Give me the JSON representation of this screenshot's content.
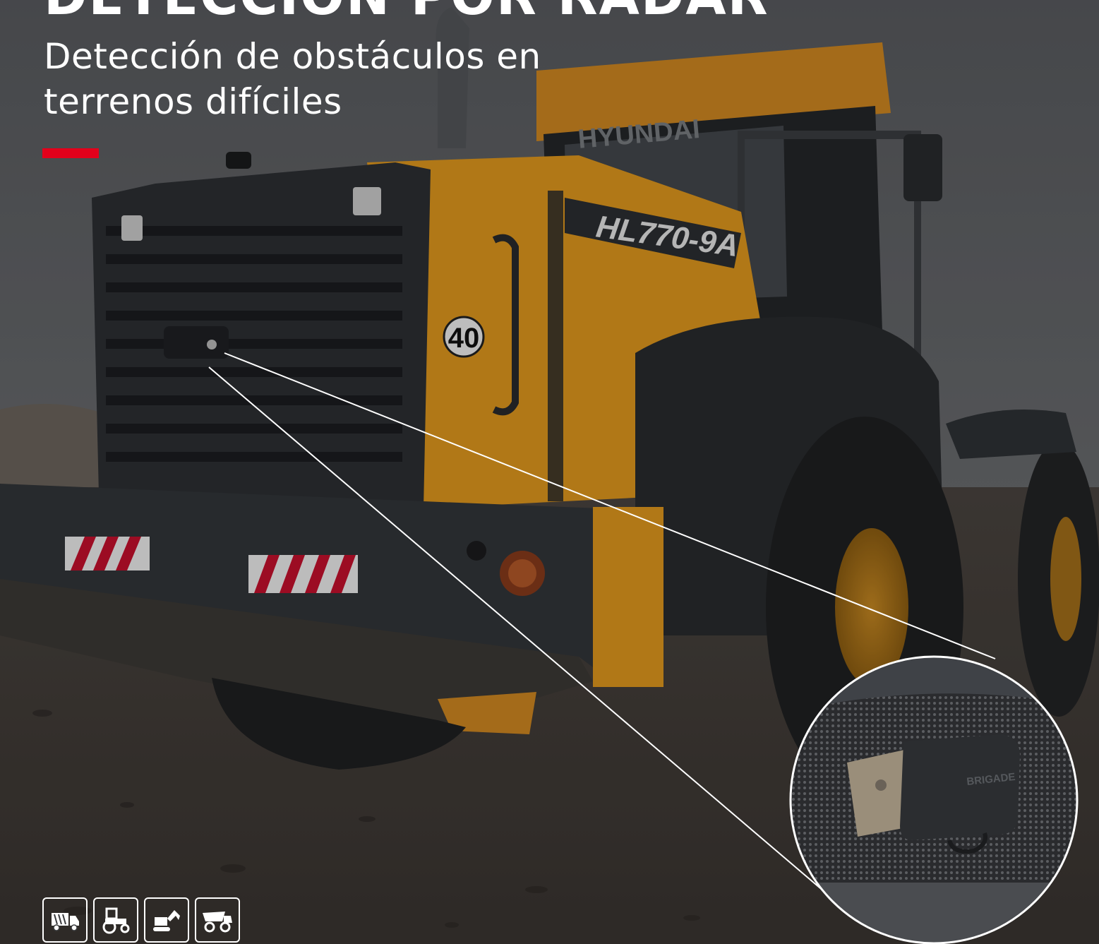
{
  "hero": {
    "title": "DETECCIÓN POR RADAR",
    "subtitle_line1": "Detección de obstáculos en",
    "subtitle_line2": "terrenos difíciles"
  },
  "photo": {
    "vehicle_model": "HL770-9A",
    "vehicle_brand": "HYUNDAI",
    "speed_sign": "40",
    "sensor_brand": "BRIGADE"
  },
  "colors": {
    "accent": "#e3001b",
    "machine_yellow": "#e39a1e",
    "dark_body": "#2c2f33"
  },
  "vehicle_icons": [
    "garbage-truck-icon",
    "tractor-icon",
    "excavator-icon",
    "dump-truck-icon"
  ]
}
